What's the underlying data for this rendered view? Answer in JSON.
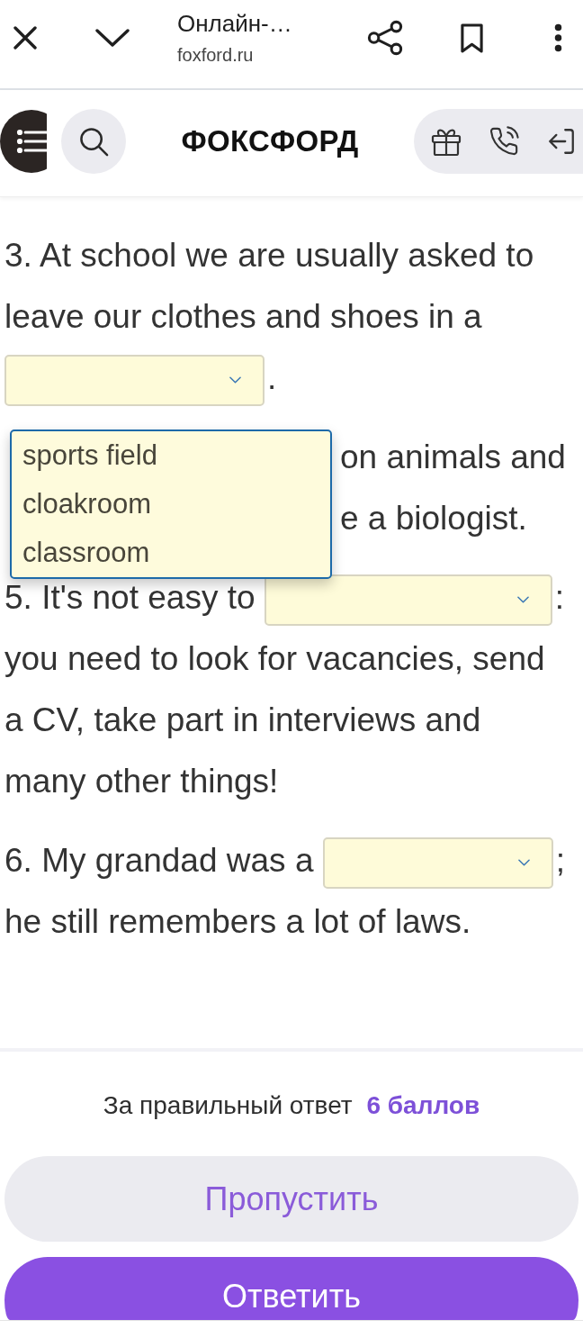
{
  "browser_bar": {
    "title": "Онлайн-…",
    "url": "foxford.ru"
  },
  "site_header": {
    "logo": "ФОКСФОРД"
  },
  "questions": [
    {
      "parts": [
        {
          "kind": "text",
          "text": "3. At school we are usually asked to leave our clothes and shoes in a"
        },
        {
          "kind": "blank",
          "options": [
            "sports field",
            "cloakroom",
            "classroom"
          ]
        },
        {
          "kind": "text",
          "text": "."
        }
      ]
    },
    {
      "parts": [
        {
          "kind": "fragment",
          "text": "on animals and"
        },
        {
          "kind": "fragment",
          "text": "e a biologist."
        }
      ]
    },
    {
      "parts": [
        {
          "kind": "text",
          "text": "5. It's not easy to"
        },
        {
          "kind": "blank"
        },
        {
          "kind": "text",
          "text": ":"
        },
        {
          "kind": "text",
          "text": "you need to look for vacancies, send a CV, take part in interviews and many other things!"
        }
      ]
    },
    {
      "parts": [
        {
          "kind": "text",
          "text": "6. My grandad was a"
        },
        {
          "kind": "blank"
        },
        {
          "kind": "text",
          "text": ";"
        },
        {
          "kind": "text",
          "text": "he still remembers a lot of laws."
        }
      ]
    }
  ],
  "footer": {
    "reward": "За правильный ответ **6 баллов**",
    "buttons": [
      {
        "kind": "secondary",
        "label": "Пропустить"
      },
      {
        "kind": "primary",
        "label": "Ответить"
      }
    ]
  }
}
